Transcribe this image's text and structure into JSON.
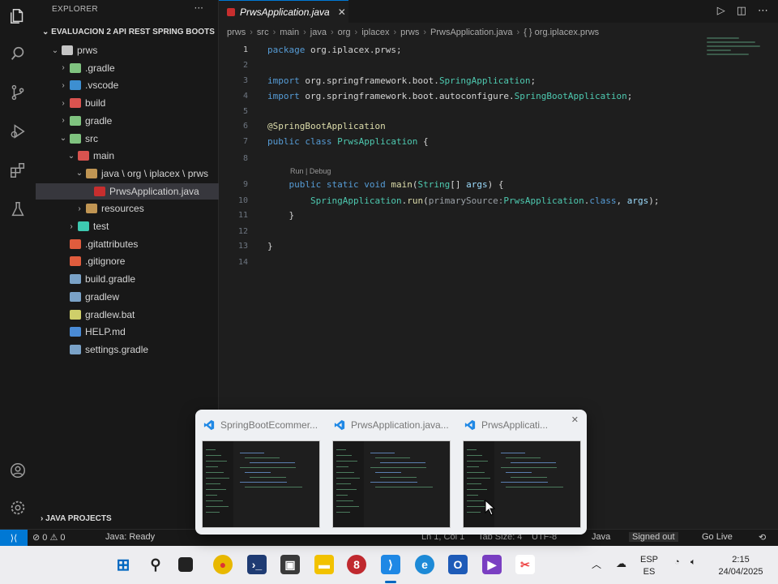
{
  "sidebar": {
    "title": "EXPLORER",
    "menu": "···",
    "project": "EVALUACION 2 API REST SPRING BOOTS",
    "items": [
      {
        "label": "prws",
        "chev": "⌄",
        "indent": 0,
        "color": "#c5c5c5"
      },
      {
        "label": ".gradle",
        "chev": "›",
        "indent": 1,
        "color": "#7fc37f"
      },
      {
        "label": ".vscode",
        "chev": "›",
        "indent": 1,
        "color": "#3d8fd1"
      },
      {
        "label": "build",
        "chev": "›",
        "indent": 1,
        "color": "#d9534f"
      },
      {
        "label": "gradle",
        "chev": "›",
        "indent": 1,
        "color": "#7fc37f"
      },
      {
        "label": "src",
        "chev": "⌄",
        "indent": 1,
        "color": "#7fc37f"
      },
      {
        "label": "main",
        "chev": "⌄",
        "indent": 2,
        "color": "#d9534f"
      },
      {
        "label": "java \\ org \\ iplacex \\ prws",
        "chev": "⌄",
        "indent": 3,
        "color": "#c09553"
      },
      {
        "label": "PrwsApplication.java",
        "chev": "",
        "indent": 4,
        "color": "#c72e2e",
        "selected": true
      },
      {
        "label": "resources",
        "chev": "›",
        "indent": 3,
        "color": "#c09553"
      },
      {
        "label": "test",
        "chev": "›",
        "indent": 2,
        "color": "#3dc9b0"
      },
      {
        "label": ".gitattributes",
        "chev": "",
        "indent": 1,
        "color": "#e05c3d"
      },
      {
        "label": ".gitignore",
        "chev": "",
        "indent": 1,
        "color": "#e05c3d"
      },
      {
        "label": "build.gradle",
        "chev": "",
        "indent": 1,
        "color": "#7aa2c7"
      },
      {
        "label": "gradlew",
        "chev": "",
        "indent": 1,
        "color": "#7aa2c7"
      },
      {
        "label": "gradlew.bat",
        "chev": "",
        "indent": 1,
        "color": "#cfcf6a"
      },
      {
        "label": "HELP.md",
        "chev": "",
        "indent": 1,
        "color": "#4a8bd6"
      },
      {
        "label": "settings.gradle",
        "chev": "",
        "indent": 1,
        "color": "#7aa2c7"
      }
    ],
    "bottom_section": "JAVA PROJECTS"
  },
  "tab": {
    "label": "PrwsApplication.java",
    "close": "✕"
  },
  "breadcrumb": [
    "prws",
    "src",
    "main",
    "java",
    "org",
    "iplacex",
    "prws",
    "PrwsApplication.java",
    "{ } org.iplacex.prws"
  ],
  "code": {
    "codelens": "Run | Debug",
    "lines": [
      {
        "n": "1",
        "active": true,
        "tokens": [
          [
            "kw",
            "package "
          ],
          [
            "pl",
            "org.iplacex.prws;"
          ]
        ]
      },
      {
        "n": "2",
        "tokens": []
      },
      {
        "n": "3",
        "tokens": [
          [
            "kw",
            "import "
          ],
          [
            "pl",
            "org.springframework.boot."
          ],
          [
            "ty",
            "SpringApplication"
          ],
          [
            "pl",
            ";"
          ]
        ]
      },
      {
        "n": "4",
        "tokens": [
          [
            "kw",
            "import "
          ],
          [
            "pl",
            "org.springframework.boot.autoconfigure."
          ],
          [
            "ty",
            "SpringBootApplication"
          ],
          [
            "pl",
            ";"
          ]
        ]
      },
      {
        "n": "5",
        "tokens": []
      },
      {
        "n": "6",
        "tokens": [
          [
            "an",
            "@SpringBootApplication"
          ]
        ]
      },
      {
        "n": "7",
        "tokens": [
          [
            "kw",
            "public class "
          ],
          [
            "ty",
            "PrwsApplication"
          ],
          [
            "pl",
            " {"
          ]
        ]
      },
      {
        "n": "8",
        "tokens": []
      },
      {
        "n": "9",
        "tokens": [
          [
            "pl",
            "    "
          ],
          [
            "kw",
            "public static void "
          ],
          [
            "fn",
            "main"
          ],
          [
            "pl",
            "("
          ],
          [
            "ty",
            "String"
          ],
          [
            "pl",
            "[] "
          ],
          [
            "va",
            "args"
          ],
          [
            "pl",
            ") {"
          ]
        ]
      },
      {
        "n": "10",
        "tokens": [
          [
            "pl",
            "        "
          ],
          [
            "ty",
            "SpringApplication"
          ],
          [
            "pl",
            "."
          ],
          [
            "fn",
            "run"
          ],
          [
            "pl",
            "("
          ],
          [
            "ph",
            "primarySource:"
          ],
          [
            "ty",
            "PrwsApplication"
          ],
          [
            "pl",
            "."
          ],
          [
            "kw",
            "class"
          ],
          [
            "pl",
            ", "
          ],
          [
            "va",
            "args"
          ],
          [
            "pl",
            ");"
          ]
        ]
      },
      {
        "n": "11",
        "tokens": [
          [
            "pl",
            "    }"
          ]
        ]
      },
      {
        "n": "12",
        "tokens": []
      },
      {
        "n": "13",
        "tokens": [
          [
            "pl",
            "}"
          ]
        ]
      },
      {
        "n": "14",
        "tokens": []
      }
    ]
  },
  "statusbar": {
    "errors": "⊘ 0 ⚠ 0",
    "java": "Java: Ready",
    "position": "Ln 1, Col 1",
    "spaces": "Tab Size: 4",
    "encoding": "UTF-8",
    "lang": "Java",
    "signed": "Signed out",
    "golive": "Go Live"
  },
  "preview": {
    "items": [
      {
        "title": "SpringBootEcommer..."
      },
      {
        "title": "PrwsApplication.java..."
      },
      {
        "title": "PrwsApplicati..."
      }
    ],
    "close": "✕"
  },
  "taskbar": {
    "lang_top": "ESP",
    "lang_bottom": "ES",
    "time": "2:15",
    "date": "24/04/2025"
  },
  "colors": {
    "accent": "#0078d4",
    "editor_bg": "#1e1e1e",
    "sidebar_bg": "#181818"
  }
}
